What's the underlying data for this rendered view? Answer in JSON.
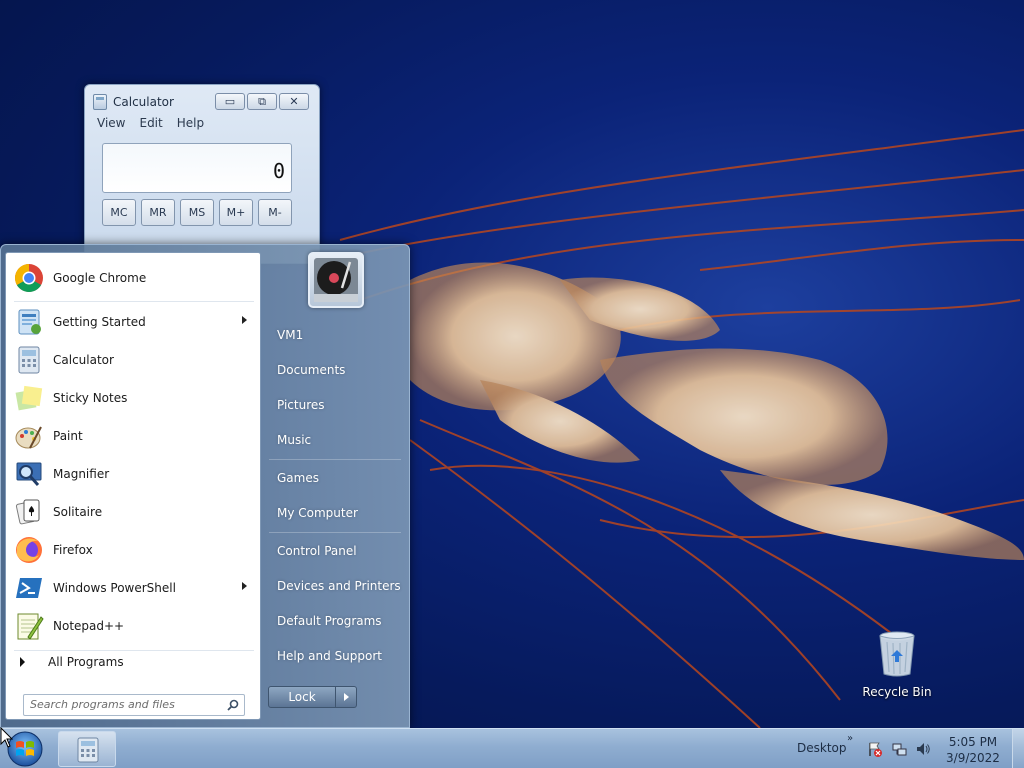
{
  "calculator": {
    "title": "Calculator",
    "menu": [
      "View",
      "Edit",
      "Help"
    ],
    "display": "0",
    "memory_keys": [
      "MC",
      "MR",
      "MS",
      "M+",
      "M-"
    ],
    "controls": {
      "minimize": "▭",
      "restore": "⧉",
      "close": "✕"
    }
  },
  "start_menu": {
    "programs": [
      {
        "label": "Google Chrome",
        "icon": "chrome-icon",
        "submenu": false
      },
      {
        "label": "Getting Started",
        "icon": "getting-started-icon",
        "submenu": true
      },
      {
        "label": "Calculator",
        "icon": "calculator-icon",
        "submenu": false
      },
      {
        "label": "Sticky Notes",
        "icon": "sticky-notes-icon",
        "submenu": false
      },
      {
        "label": "Paint",
        "icon": "paint-icon",
        "submenu": false
      },
      {
        "label": "Magnifier",
        "icon": "magnifier-icon",
        "submenu": false
      },
      {
        "label": "Solitaire",
        "icon": "solitaire-icon",
        "submenu": false
      },
      {
        "label": "Firefox",
        "icon": "firefox-icon",
        "submenu": false
      },
      {
        "label": "Windows PowerShell",
        "icon": "powershell-icon",
        "submenu": true
      },
      {
        "label": "Notepad++",
        "icon": "notepadpp-icon",
        "submenu": false
      }
    ],
    "all_programs": "All Programs",
    "search_placeholder": "Search programs and files",
    "right_items": [
      "VM1",
      "Documents",
      "Pictures",
      "Music",
      "Games",
      "My Computer",
      "Control Panel",
      "Devices and Printers",
      "Default Programs",
      "Help and Support"
    ],
    "lock_label": "Lock"
  },
  "desktop": {
    "recycle_bin_label": "Recycle Bin"
  },
  "taskbar": {
    "desktop_label": "Desktop",
    "chevron": "»",
    "time": "5:05 PM",
    "date": "3/9/2022"
  }
}
